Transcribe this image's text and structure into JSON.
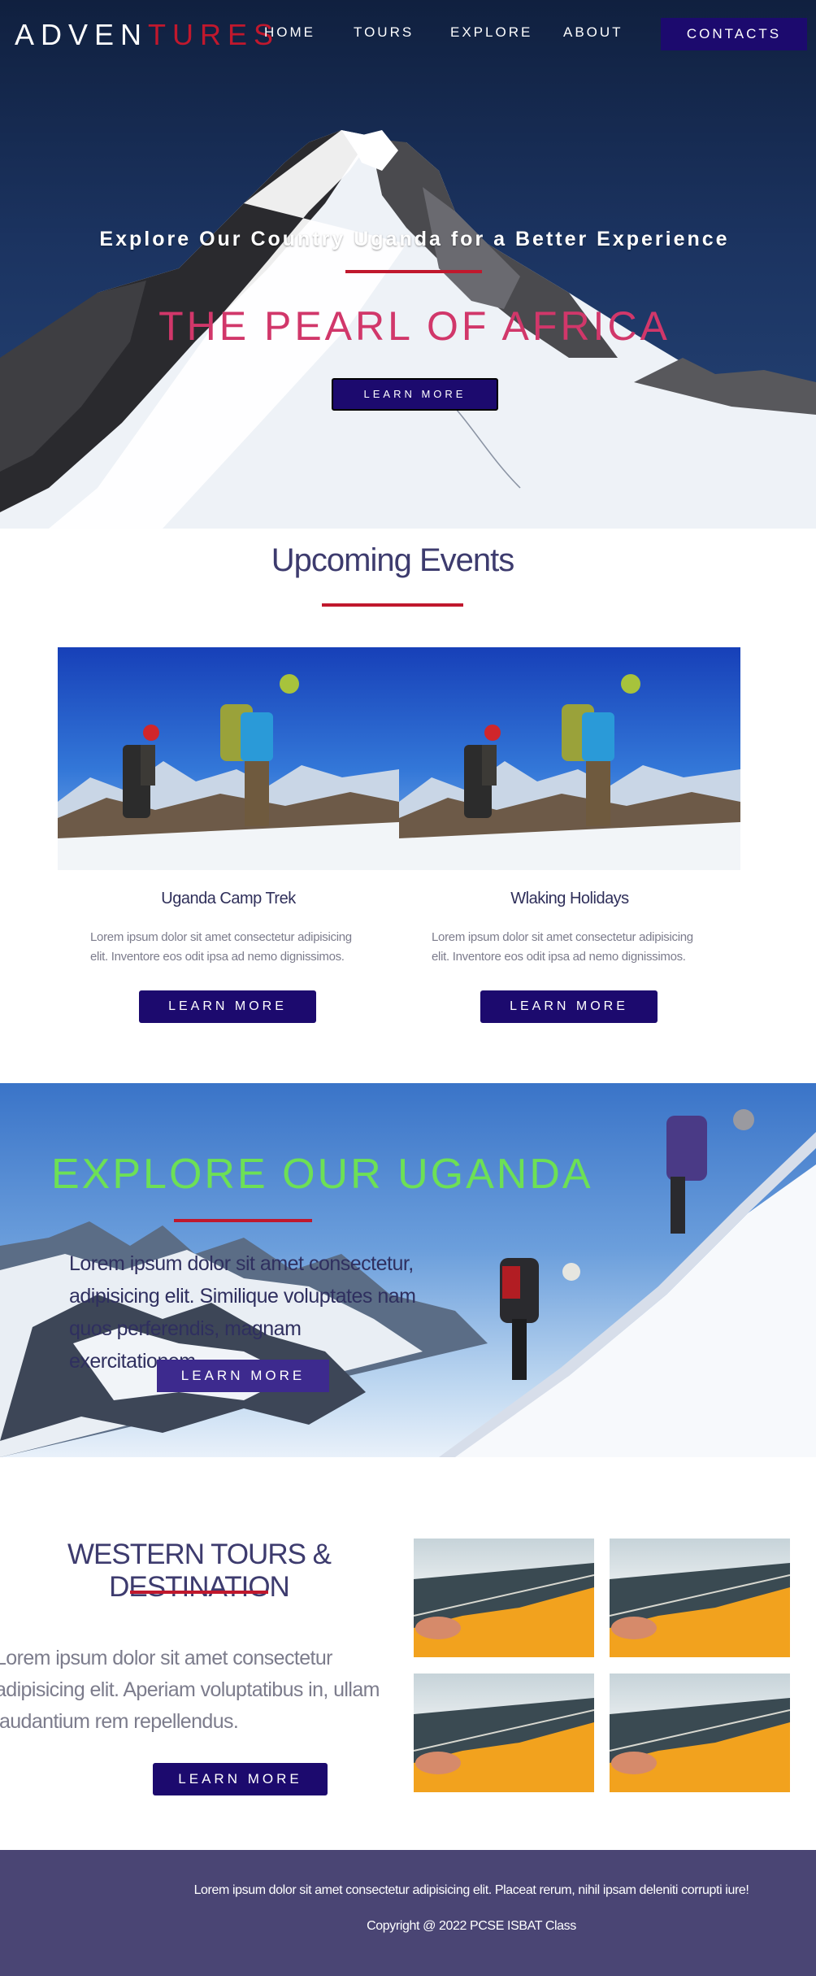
{
  "nav": {
    "logo_part1": "ADVEN",
    "logo_part2": "TURES",
    "links": [
      "HOME",
      "TOURS",
      "EXPLORE",
      "ABOUT"
    ],
    "cta": "CONTACTS"
  },
  "hero": {
    "subtitle": "Explore Our Country Uganda for a Better Experience",
    "title": "THE PEARL OF AFRICA",
    "button": "LEARN MORE"
  },
  "events": {
    "title": "Upcoming Events",
    "cards": [
      {
        "title": "Uganda Camp Trek",
        "text": "Lorem ipsum dolor sit amet consectetur adipisicing elit. Inventore eos odit ipsa ad nemo dignissimos.",
        "button": "LEARN MORE"
      },
      {
        "title": "Wlaking Holidays",
        "text": "Lorem ipsum dolor sit amet consectetur adipisicing elit. Inventore eos odit ipsa ad nemo dignissimos.",
        "button": "LEARN MORE"
      }
    ]
  },
  "explore": {
    "title": "EXPLORE OUR UGANDA",
    "text": "Lorem ipsum dolor sit amet consectetur, adipisicing elit. Similique voluptates nam quos perferendis, magnam exercitationem.",
    "button": "LEARN MORE"
  },
  "western": {
    "title": "WESTERN TOURS & DESTINATION",
    "text": "Lorem ipsum dolor sit amet consectetur adipisicing elit. Aperiam voluptatibus in, ullam laudantium rem repellendus.",
    "button": "LEARN MORE"
  },
  "footer": {
    "line1": "Lorem ipsum dolor sit amet consectetur adipisicing elit. Placeat rerum, nihil ipsam deleniti corrupti iure!",
    "copyright": "Copyright @ 2022 PCSE ISBAT Class"
  },
  "colors": {
    "brand_dark": "#1c0a6e",
    "accent_red": "#c0182d",
    "hero_title_pink": "#d1376a",
    "explore_green": "#6de055",
    "heading": "#3d3b6e",
    "footer_bg": "#4a4574"
  }
}
